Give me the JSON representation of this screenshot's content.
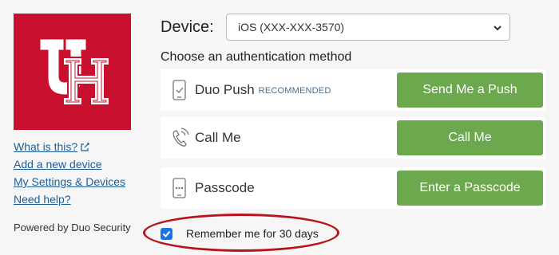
{
  "sidebar": {
    "logo_text": "UH",
    "links": [
      {
        "label": "What is this?"
      },
      {
        "label": "Add a new device"
      },
      {
        "label": "My Settings & Devices"
      },
      {
        "label": "Need help?"
      }
    ],
    "powered_by": "Powered by Duo Security"
  },
  "device": {
    "label": "Device:",
    "selected": "iOS (XXX-XXX-3570)"
  },
  "prompt": "Choose an authentication method",
  "methods": [
    {
      "label": "Duo Push",
      "badge": "RECOMMENDED",
      "button": "Send Me a Push",
      "icon": "phone-push-icon"
    },
    {
      "label": "Call Me",
      "badge": "",
      "button": "Call Me",
      "icon": "phone-call-icon"
    },
    {
      "label": "Passcode",
      "badge": "",
      "button": "Enter a Passcode",
      "icon": "passcode-icon"
    }
  ],
  "remember": {
    "label": "Remember me for 30 days",
    "checked": true
  },
  "colors": {
    "brand_red": "#c8102e",
    "button_green": "#6ca84e",
    "link_blue": "#1c5d98",
    "highlight_ring": "#b8141f"
  }
}
